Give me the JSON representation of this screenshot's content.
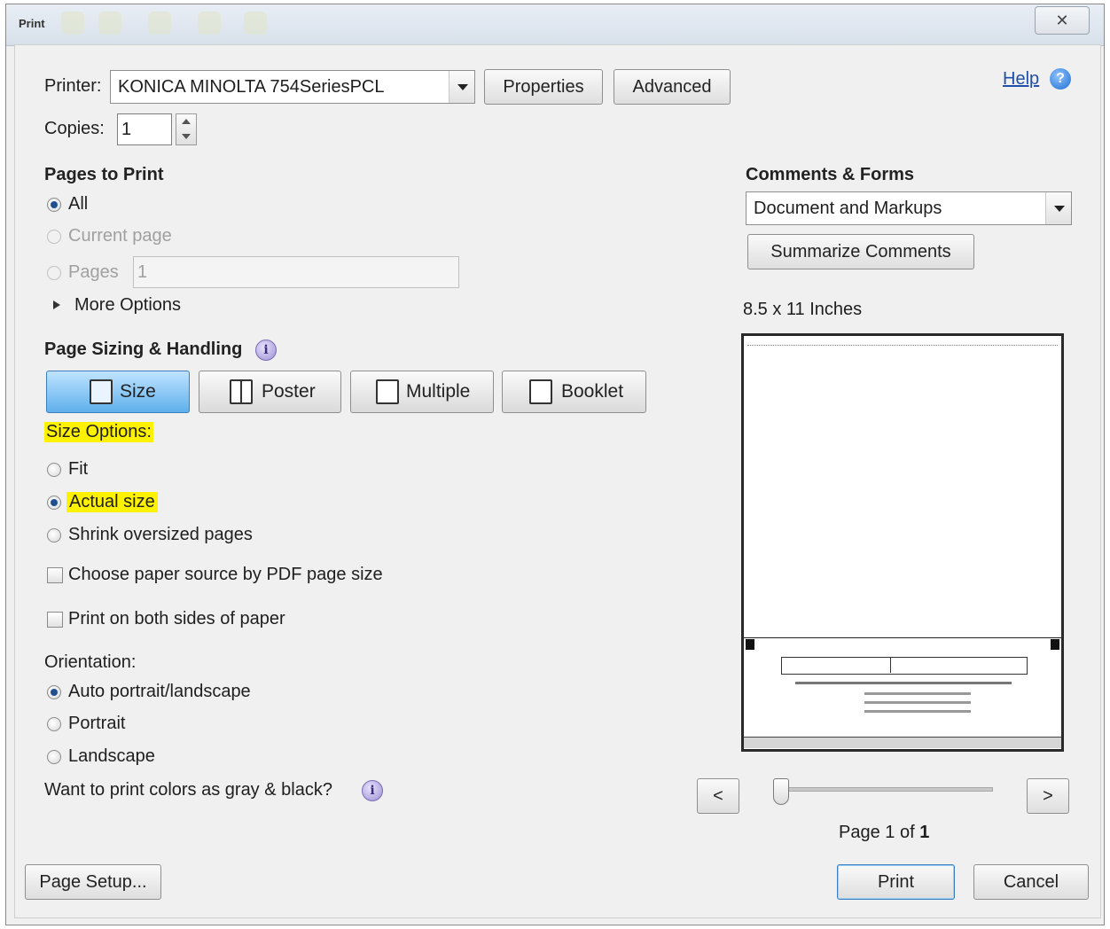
{
  "window": {
    "title": "Print",
    "close_glyph": "✕"
  },
  "printer": {
    "label": "Printer:",
    "value": "KONICA MINOLTA 754SeriesPCL",
    "properties_label": "Properties",
    "advanced_label": "Advanced"
  },
  "help": {
    "label": "Help",
    "icon_glyph": "?"
  },
  "copies": {
    "label": "Copies:",
    "value": "1"
  },
  "pages_to_print": {
    "heading": "Pages to Print",
    "all_label": "All",
    "current_page_label": "Current page",
    "pages_label": "Pages",
    "pages_value": "1",
    "more_options_label": "More Options",
    "selected": "All"
  },
  "page_sizing": {
    "heading": "Page Sizing & Handling",
    "info_glyph": "i",
    "tabs": [
      {
        "label": "Size",
        "active": true
      },
      {
        "label": "Poster",
        "active": false
      },
      {
        "label": "Multiple",
        "active": false
      },
      {
        "label": "Booklet",
        "active": false
      }
    ],
    "size_options_label": "Size Options:",
    "fit_label": "Fit",
    "actual_size_label": "Actual size",
    "shrink_label": "Shrink oversized pages",
    "selected": "Actual size",
    "choose_paper_label": "Choose paper source by PDF page size",
    "both_sides_label": "Print on both sides of paper"
  },
  "orientation": {
    "heading": "Orientation:",
    "auto_label": "Auto portrait/landscape",
    "portrait_label": "Portrait",
    "landscape_label": "Landscape",
    "selected": "Auto portrait/landscape"
  },
  "gray_question": {
    "label": "Want to print colors as gray & black?",
    "info_glyph": "i"
  },
  "comments_forms": {
    "heading": "Comments & Forms",
    "value": "Document and Markups",
    "summarize_label": "Summarize Comments"
  },
  "preview": {
    "size_label": "8.5 x 11 Inches",
    "prev_label": "<",
    "next_label": ">",
    "page_prefix": "Page 1 of",
    "page_total": "1"
  },
  "footer": {
    "page_setup_label": "Page Setup...",
    "print_label": "Print",
    "cancel_label": "Cancel"
  },
  "colors": {
    "highlight": "#fff200",
    "active_tab": "#5fb0ec",
    "link": "#1f4fa8"
  }
}
